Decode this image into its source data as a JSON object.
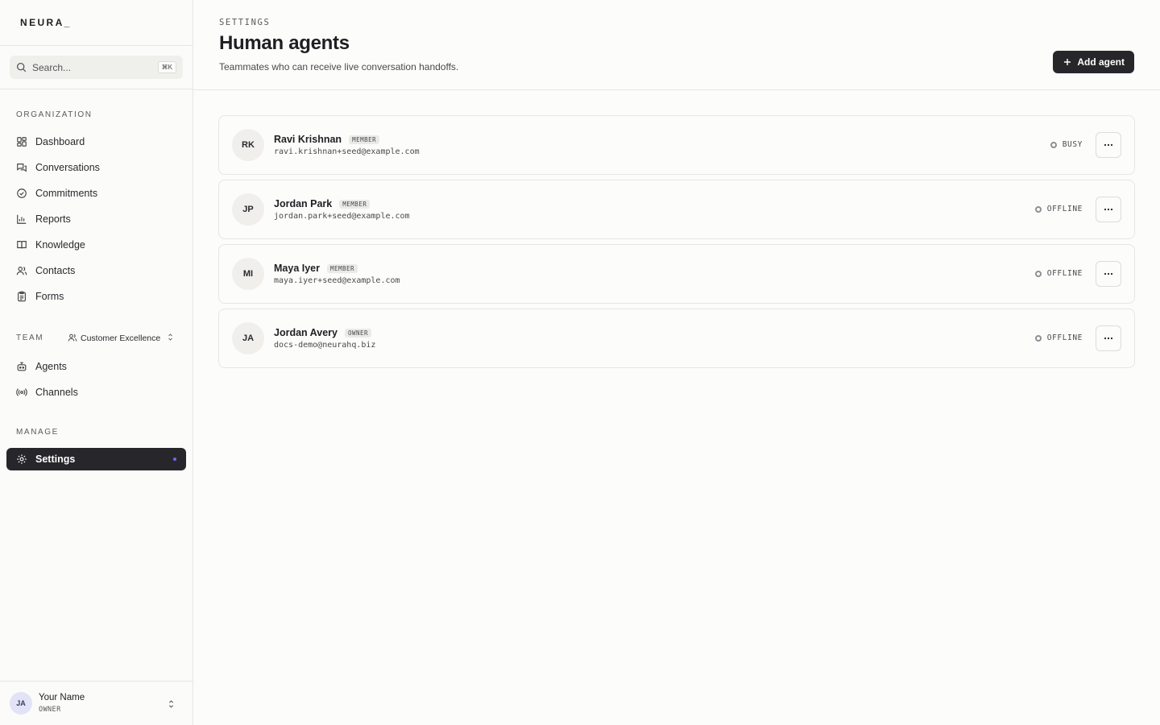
{
  "app": {
    "logo": "NEURA_"
  },
  "search": {
    "placeholder": "Search...",
    "shortcut": "⌘K"
  },
  "sidebar": {
    "organization_label": "ORGANIZATION",
    "org_items": [
      {
        "label": "Dashboard",
        "icon": "grid-icon"
      },
      {
        "label": "Conversations",
        "icon": "chat-icon"
      },
      {
        "label": "Commitments",
        "icon": "check-circle-icon"
      },
      {
        "label": "Reports",
        "icon": "bar-chart-icon"
      },
      {
        "label": "Knowledge",
        "icon": "book-icon"
      },
      {
        "label": "Contacts",
        "icon": "users-icon"
      },
      {
        "label": "Forms",
        "icon": "clipboard-icon"
      }
    ],
    "team_label": "TEAM",
    "team_selected": "Customer Excellence",
    "team_items": [
      {
        "label": "Agents",
        "icon": "bot-icon"
      },
      {
        "label": "Channels",
        "icon": "radio-icon"
      }
    ],
    "manage_label": "MANAGE",
    "manage_items": [
      {
        "label": "Settings",
        "icon": "gear-icon",
        "active": true
      }
    ],
    "user": {
      "initials": "JA",
      "name": "Your Name",
      "role": "OWNER"
    }
  },
  "header": {
    "eyebrow": "SETTINGS",
    "title": "Human agents",
    "subtitle": "Teammates who can receive live conversation handoffs.",
    "add_label": "Add agent"
  },
  "agents": [
    {
      "initials": "RK",
      "name": "Ravi Krishnan",
      "role": "MEMBER",
      "email": "ravi.krishnan+seed@example.com",
      "status": "BUSY"
    },
    {
      "initials": "JP",
      "name": "Jordan Park",
      "role": "MEMBER",
      "email": "jordan.park+seed@example.com",
      "status": "OFFLINE"
    },
    {
      "initials": "MI",
      "name": "Maya Iyer",
      "role": "MEMBER",
      "email": "maya.iyer+seed@example.com",
      "status": "OFFLINE"
    },
    {
      "initials": "JA",
      "name": "Jordan Avery",
      "role": "OWNER",
      "email": "docs-demo@neurahq.biz",
      "status": "OFFLINE"
    }
  ],
  "colors": {
    "accent_dark": "#27272b",
    "active_dot": "#6b6bf0",
    "status_ring": "#8d8f96"
  }
}
